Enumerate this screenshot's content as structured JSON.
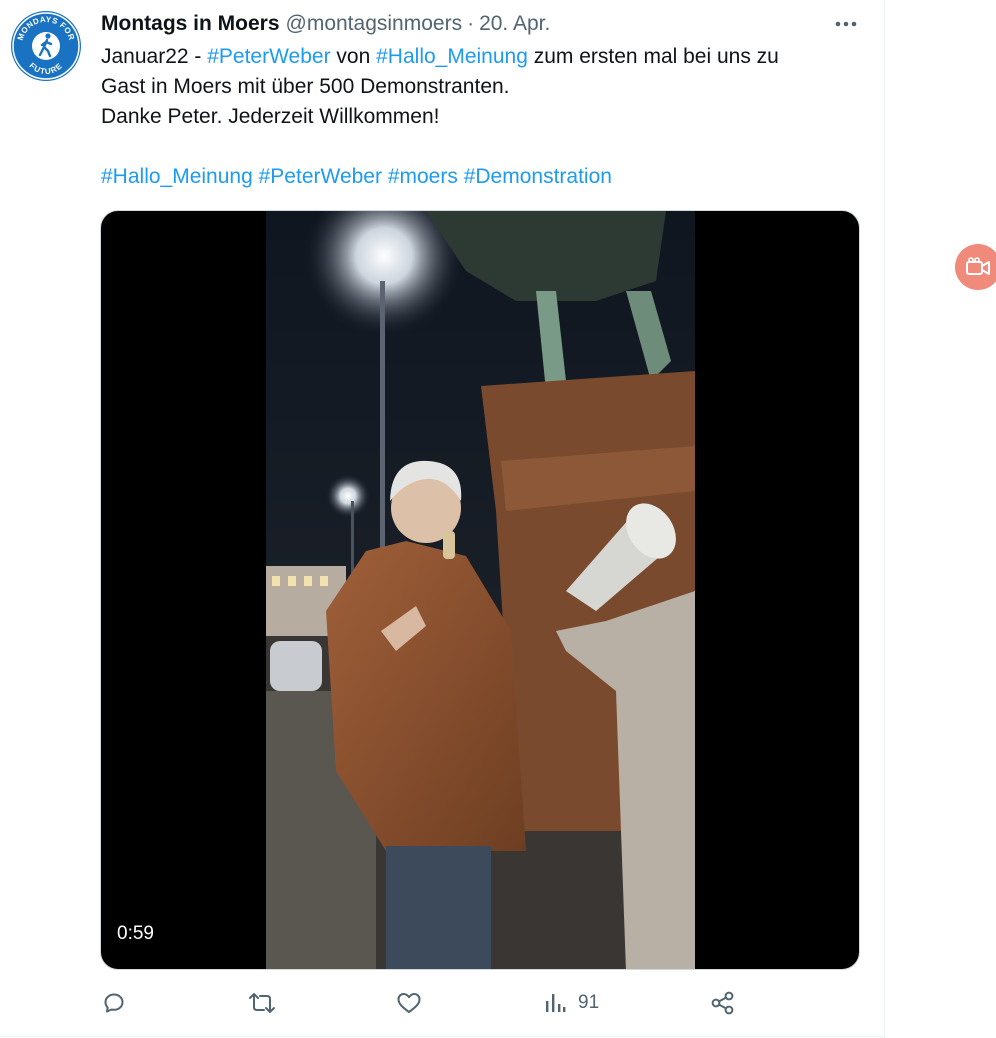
{
  "tweet": {
    "author_name": "Montags in Moers",
    "handle": "@montagsinmoers",
    "separator": "·",
    "date": "20. Apr.",
    "avatar": {
      "icon": "walking-person-icon",
      "top_text": "MONDAYS FOR",
      "bottom_text": "FUTURE",
      "color": "#1a73c2"
    },
    "text": {
      "line1": {
        "prefix": "Januar22 - ",
        "tag1": "#PeterWeber",
        "mid": " von ",
        "tag2": "#Hallo_Meinung",
        "suffix": " zum ersten mal bei uns zu"
      },
      "line2": "Gast in Moers mit über 500 Demonstranten.",
      "line3": "Danke Peter. Jederzeit Willkommen!",
      "hashtags": [
        "#Hallo_Meinung",
        "#PeterWeber",
        "#moers",
        "#Demonstration"
      ]
    },
    "video": {
      "duration": "0:59"
    },
    "actions": {
      "reply_icon": "reply-icon",
      "retweet_icon": "retweet-icon",
      "like_icon": "heart-icon",
      "views_icon": "views-icon",
      "views_count": "91",
      "share_icon": "share-icon"
    }
  },
  "side_button": {
    "icon": "video-camera-icon",
    "color": "#f08a7a"
  },
  "colors": {
    "link": "#1d9bf0",
    "text": "#0f1419",
    "muted": "#536471"
  }
}
